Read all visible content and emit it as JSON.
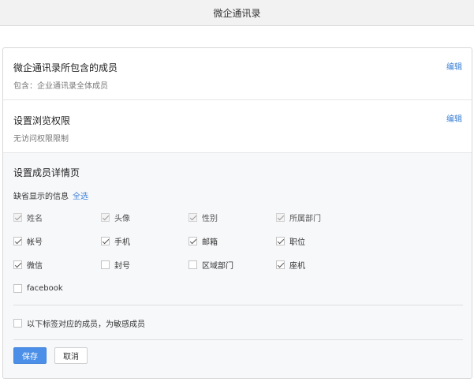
{
  "window": {
    "title": "微企通讯录"
  },
  "members_section": {
    "title": "微企通讯录所包含的成员",
    "subtitle": "包含：企业通讯录全体成员",
    "edit_label": "编辑"
  },
  "permission_section": {
    "title": "设置浏览权限",
    "subtitle": "无访问权限限制",
    "edit_label": "编辑"
  },
  "detail_section": {
    "title": "设置成员详情页",
    "default_info_label": "缺省显示的信息",
    "select_all_label": "全选",
    "fields": [
      {
        "label": "姓名",
        "checked": true,
        "disabled": true
      },
      {
        "label": "头像",
        "checked": true,
        "disabled": true
      },
      {
        "label": "性别",
        "checked": true,
        "disabled": true
      },
      {
        "label": "所属部门",
        "checked": true,
        "disabled": true
      },
      {
        "label": "帐号",
        "checked": true,
        "disabled": false
      },
      {
        "label": "手机",
        "checked": true,
        "disabled": false
      },
      {
        "label": "邮箱",
        "checked": true,
        "disabled": false
      },
      {
        "label": "职位",
        "checked": true,
        "disabled": false
      },
      {
        "label": "微信",
        "checked": true,
        "disabled": false
      },
      {
        "label": "封号",
        "checked": false,
        "disabled": false
      },
      {
        "label": "区域部门",
        "checked": false,
        "disabled": false
      },
      {
        "label": "座机",
        "checked": true,
        "disabled": false
      },
      {
        "label": "facebook",
        "checked": false,
        "disabled": false
      }
    ],
    "sensitive_option": {
      "label": "以下标签对应的成员，为敏感成员",
      "checked": false
    },
    "save_label": "保存",
    "cancel_label": "取消"
  }
}
